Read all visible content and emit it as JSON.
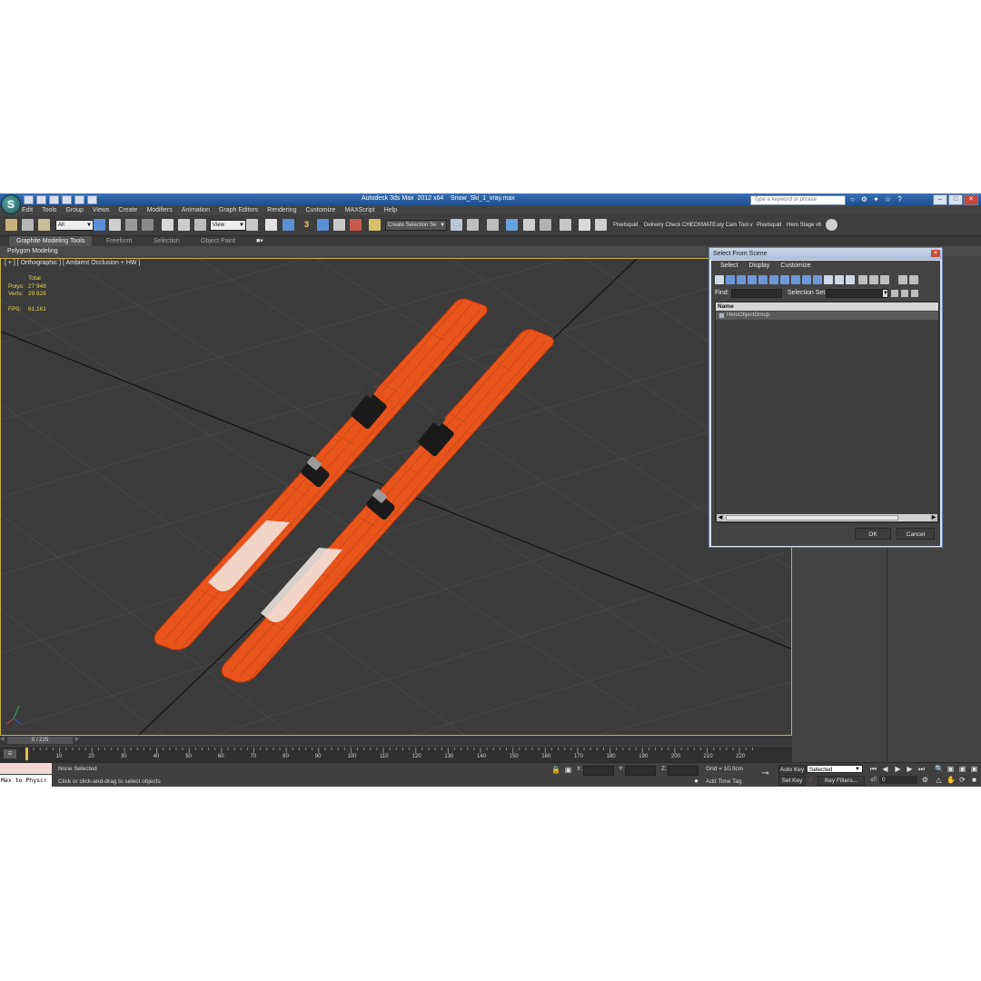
{
  "window": {
    "app_title": "Autodesk 3ds Max  2012 x64",
    "file_name": "Snow_Ski_1_vray.max",
    "search_placeholder": "Type a keyword or phrase",
    "logo_letter": "S"
  },
  "menu": [
    "Edit",
    "Tools",
    "Group",
    "Views",
    "Create",
    "Modifiers",
    "Animation",
    "Graph Editors",
    "Rendering",
    "Customize",
    "MAXScript",
    "Help"
  ],
  "toolbar": {
    "filter_value": "All",
    "ref_coord_value": "View",
    "snap_label": "3",
    "named_selection_placeholder": "Create Selection Se",
    "plugins": [
      "Pixelsquid",
      "Delivery Check",
      "CHECKMATE",
      "uty Cam Tool v",
      "Pixelsquid",
      "Hero Stage v6"
    ]
  },
  "ribbon": {
    "tabs": [
      "Graphite Modeling Tools",
      "Freeform",
      "Selection",
      "Object Paint"
    ],
    "active_tab": "Graphite Modeling Tools",
    "panel": "Polygon Modeling"
  },
  "viewport": {
    "label": "[ + ] [ Orthographic ] [ Ambient Occlusion + HW ]",
    "stats": {
      "header": "Total",
      "polys_label": "Polys:",
      "polys_value": "27 948",
      "verts_label": "Verts:",
      "verts_value": "29 826",
      "fps_label": "FPS:",
      "fps_value": "61,161"
    }
  },
  "timeline": {
    "slider_text": "0 / 225",
    "frames": [
      "0",
      "10",
      "20",
      "30",
      "40",
      "50",
      "60",
      "70",
      "80",
      "90",
      "100",
      "110",
      "120",
      "130",
      "140",
      "150",
      "160",
      "170",
      "180",
      "190",
      "200",
      "210",
      "220"
    ],
    "current_frame_fraction": 0
  },
  "status": {
    "maxscript_text": "Max to Physcr",
    "selection_text": "None Selected",
    "prompt_text": "Click or click-and-drag to select objects",
    "x_label": "X:",
    "y_label": "Y:",
    "z_label": "Z:",
    "grid_text": "Grid = 10,0cm",
    "add_time_tag": "Add Time Tag",
    "auto_key": "Auto Key",
    "set_key": "Set Key",
    "selected_value": "Selected",
    "key_filters": "Key Filters...",
    "frame_value": "0"
  },
  "dialog": {
    "title": "Select From Scene",
    "menu": [
      "Select",
      "Display",
      "Customize"
    ],
    "find_label": "Find:",
    "selection_set_label": "Selection Set:",
    "column_name": "Name",
    "items": [
      "HeroObjectGroup"
    ],
    "ok_label": "OK",
    "cancel_label": "Cancel"
  },
  "colors": {
    "ski_orange": "#e8541c",
    "viewport_bg": "#3b3b3b",
    "titlebar_blue": "#2b5ea3",
    "stats_yellow": "#e6d650"
  }
}
